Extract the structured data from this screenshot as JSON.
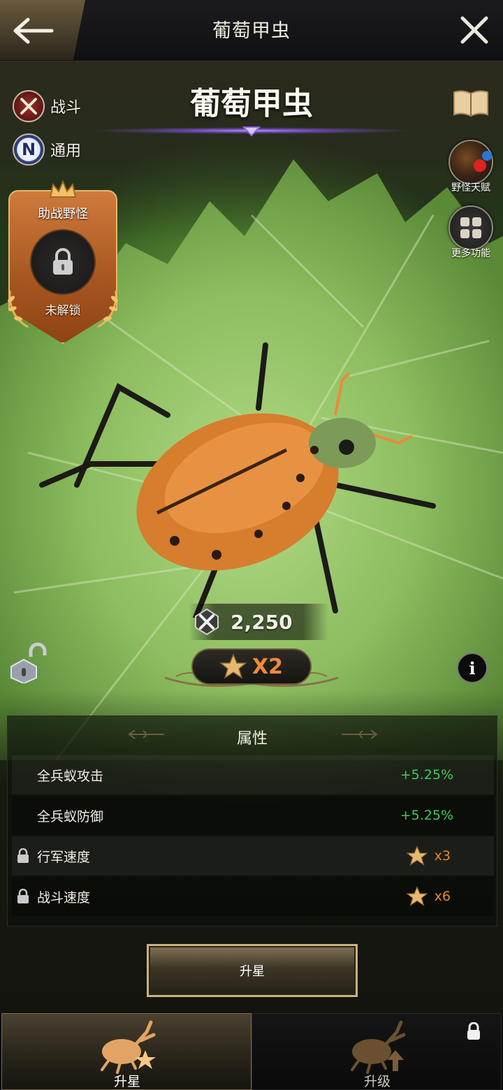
{
  "header": {
    "title": "葡萄甲虫"
  },
  "monster": {
    "name": "葡萄甲虫",
    "tags": [
      {
        "label": "战斗",
        "icon": "crossed-swords-icon"
      },
      {
        "label": "通用",
        "icon": "letter-n-icon",
        "glyph": "N"
      }
    ],
    "power": "2,250",
    "stars": "X2"
  },
  "side_buttons": {
    "talent": "野怪天赋",
    "more": "更多功能"
  },
  "assist": {
    "title": "助战野怪",
    "status": "未解锁"
  },
  "attributes": {
    "title": "属性",
    "rows": [
      {
        "name": "全兵蚁攻击",
        "value": "+5.25%",
        "locked": false
      },
      {
        "name": "全兵蚁防御",
        "value": "+5.25%",
        "locked": false
      },
      {
        "name": "行军速度",
        "requirement": "x3",
        "locked": true
      },
      {
        "name": "战斗速度",
        "requirement": "x6",
        "locked": true
      }
    ]
  },
  "actions": {
    "upstar": "升星"
  },
  "tabs": [
    {
      "label": "升星",
      "active": true,
      "locked": false
    },
    {
      "label": "升级",
      "active": false,
      "locked": true
    }
  ],
  "colors": {
    "positive": "#3ccd57",
    "star_requirement": "#e9862f",
    "gold_frame": "#c9b27e"
  }
}
